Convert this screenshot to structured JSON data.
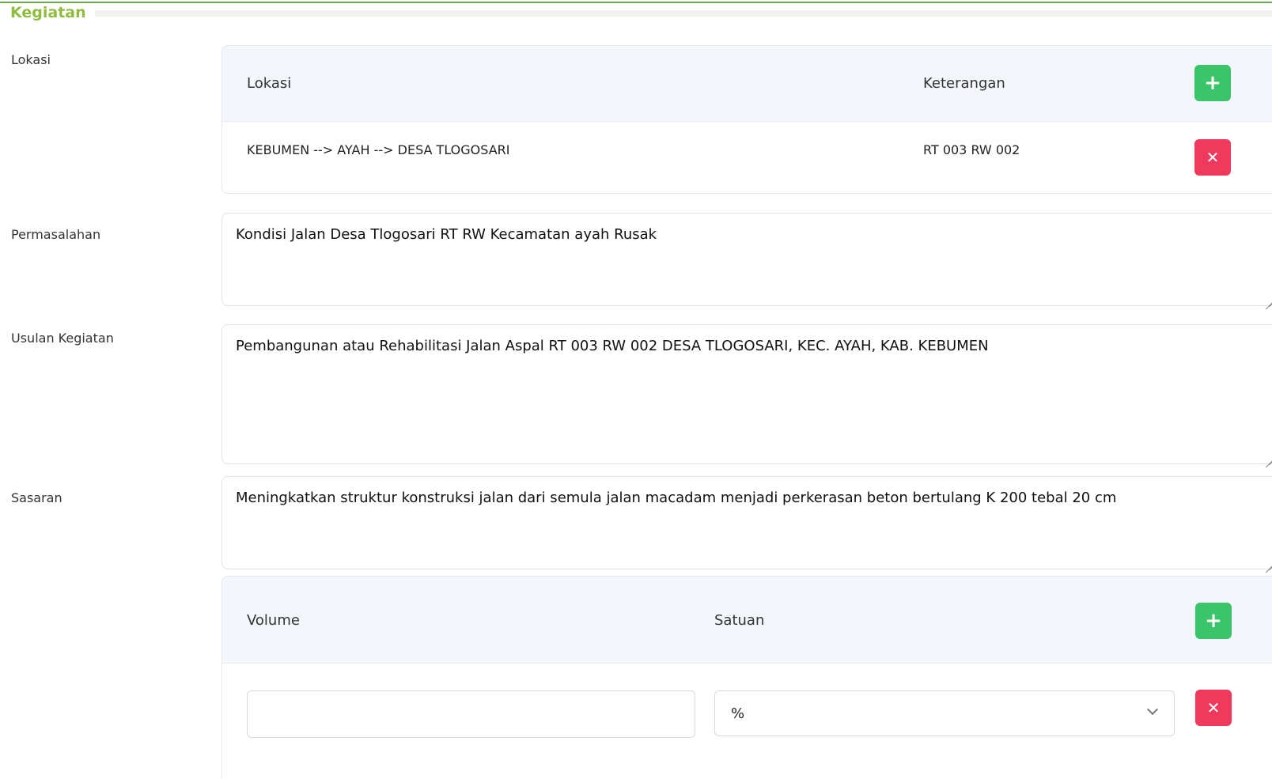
{
  "section": {
    "title": "Kegiatan"
  },
  "fields": {
    "lokasi_label": "Lokasi",
    "permasalahan_label": "Permasalahan",
    "usulan_label": "Usulan Kegiatan",
    "sasaran_label": "Sasaran"
  },
  "lokasi_table": {
    "headers": {
      "lokasi": "Lokasi",
      "keterangan": "Keterangan"
    },
    "add_icon": "plus-icon",
    "rows": [
      {
        "lokasi": "KEBUMEN --> AYAH --> DESA TLOGOSARI",
        "keterangan": "RT 003 RW 002",
        "delete_icon": "close-icon"
      }
    ]
  },
  "permasalahan": {
    "value": "Kondisi Jalan Desa Tlogosari RT   RW   Kecamatan ayah Rusak"
  },
  "usulan": {
    "value": "Pembangunan atau Rehabilitasi Jalan Aspal  RT 003 RW 002 DESA TLOGOSARI, KEC. AYAH, KAB. KEBUMEN"
  },
  "sasaran": {
    "value": "Meningkatkan struktur konstruksi jalan dari semula jalan macadam menjadi perkerasan beton bertulang K 200 tebal 20 cm"
  },
  "volume_table": {
    "headers": {
      "volume": "Volume",
      "satuan": "Satuan"
    },
    "rows": [
      {
        "volume": "",
        "satuan": "%"
      }
    ]
  },
  "colors": {
    "accent": "#8fbc3f",
    "add": "#3bc46a",
    "delete": "#ef3a5d",
    "header_bg": "#f3f6fa"
  }
}
